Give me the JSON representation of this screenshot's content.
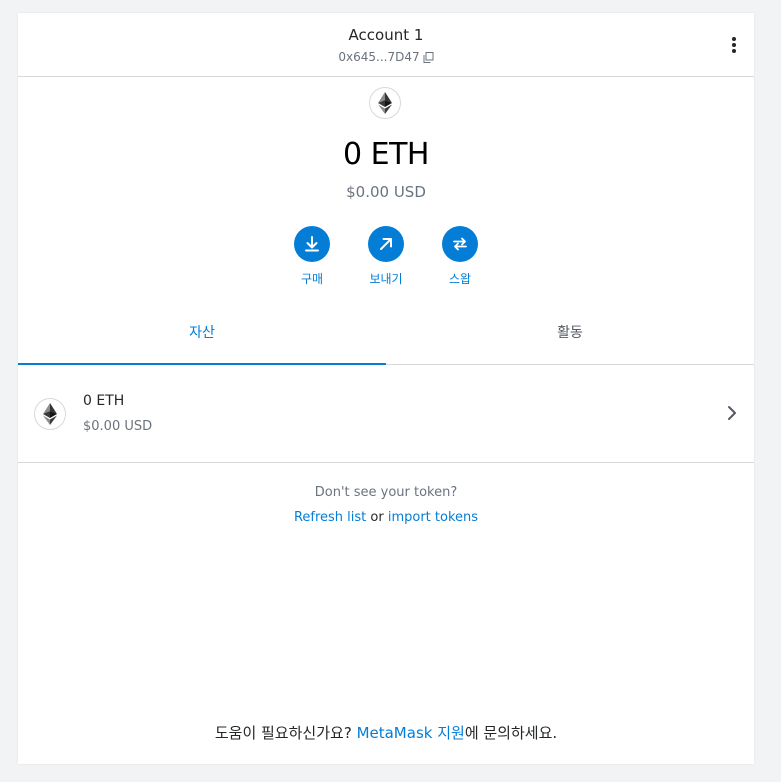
{
  "account": {
    "name": "Account 1",
    "address": "0x645...7D47"
  },
  "balance": {
    "primary": "0 ETH",
    "secondary": "$0.00 USD"
  },
  "actions": [
    {
      "label": "구매",
      "icon": "download-icon"
    },
    {
      "label": "보내기",
      "icon": "arrow-up-right-icon"
    },
    {
      "label": "스왑",
      "icon": "swap-icon"
    }
  ],
  "tabs": [
    {
      "label": "자산",
      "active": true
    },
    {
      "label": "활동",
      "active": false
    }
  ],
  "assets": [
    {
      "primary": "0 ETH",
      "secondary": "$0.00 USD"
    }
  ],
  "import_tokens": {
    "prompt": "Don't see your token?",
    "refresh_label": "Refresh list",
    "or_label": "or",
    "import_label": "import tokens"
  },
  "support": {
    "prefix": "도움이 필요하신가요?",
    "link": "MetaMask 지원",
    "suffix": "에 문의하세요."
  },
  "colors": {
    "accent": "#037dd6",
    "text": "#24272a",
    "muted": "#6a737d",
    "border": "#d6d9dc"
  }
}
